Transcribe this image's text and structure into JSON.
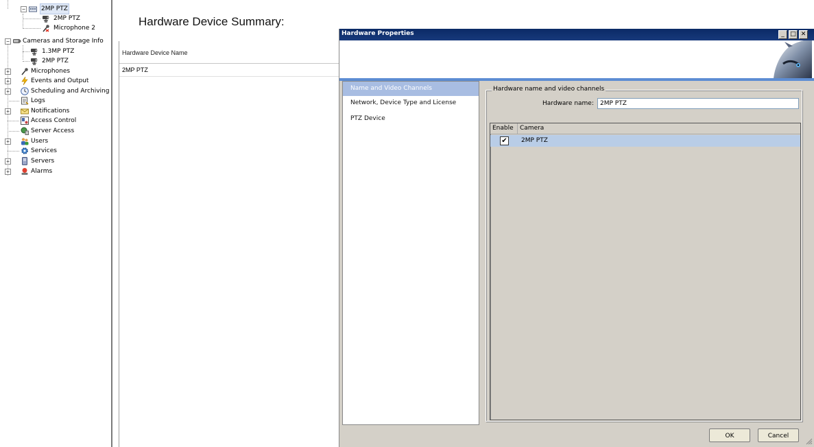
{
  "tree": {
    "nodes": [
      {
        "label": "2MP PTZ",
        "icon": "hardware-device-icon",
        "expander": "−",
        "selected": true
      },
      {
        "label": "2MP PTZ",
        "icon": "ptz-camera-icon"
      },
      {
        "label": "Microphone 2",
        "icon": "microphone-icon"
      },
      {
        "label": "Cameras and Storage Info",
        "icon": "camera-storage-icon",
        "expander": "−"
      },
      {
        "label": "1.3MP PTZ",
        "icon": "ptz-camera-icon"
      },
      {
        "label": "2MP PTZ",
        "icon": "ptz-camera-icon"
      },
      {
        "label": "Microphones",
        "icon": "microphone-icon",
        "expander": "+"
      },
      {
        "label": "Events and Output",
        "icon": "events-icon",
        "expander": "+"
      },
      {
        "label": "Scheduling and Archiving",
        "icon": "clock-icon",
        "expander": "+"
      },
      {
        "label": "Logs",
        "icon": "logs-icon"
      },
      {
        "label": "Notifications",
        "icon": "envelope-icon",
        "expander": "+"
      },
      {
        "label": "Access Control",
        "icon": "access-control-icon"
      },
      {
        "label": "Server Access",
        "icon": "server-access-icon"
      },
      {
        "label": "Users",
        "icon": "users-icon",
        "expander": "+"
      },
      {
        "label": "Services",
        "icon": "gear-icon"
      },
      {
        "label": "Servers",
        "icon": "server-icon",
        "expander": "+"
      },
      {
        "label": "Alarms",
        "icon": "alarm-icon",
        "expander": "+"
      }
    ]
  },
  "main": {
    "title": "Hardware Device Summary:",
    "table": {
      "header": "Hardware Device Name",
      "rows": [
        "2MP PTZ"
      ]
    }
  },
  "dialog": {
    "title": "Hardware Properties",
    "caption_buttons": {
      "minimize": "_",
      "maximize": "□",
      "close": "✕"
    },
    "nav": [
      {
        "label": "Name and Video Channels",
        "active": true
      },
      {
        "label": "Network, Device Type and License"
      },
      {
        "label": "PTZ Device"
      }
    ],
    "group_title": "Hardware name and video channels",
    "hardware_name_label": "Hardware name:",
    "hardware_name_value": "2MP PTZ",
    "camera_list": {
      "col_enable": "Enable",
      "col_camera": "Camera",
      "rows": [
        {
          "enabled": true,
          "check": "✔",
          "camera": "2MP PTZ"
        }
      ]
    },
    "ok_label": "OK",
    "cancel_label": "Cancel"
  },
  "colors": {
    "titlebar": "#0b2a66",
    "banner_stripe": "#5d8dd3",
    "nav_active": "#a8bde2",
    "row_selected": "#b9cde7",
    "dialog_bg": "#d4d0c8"
  }
}
